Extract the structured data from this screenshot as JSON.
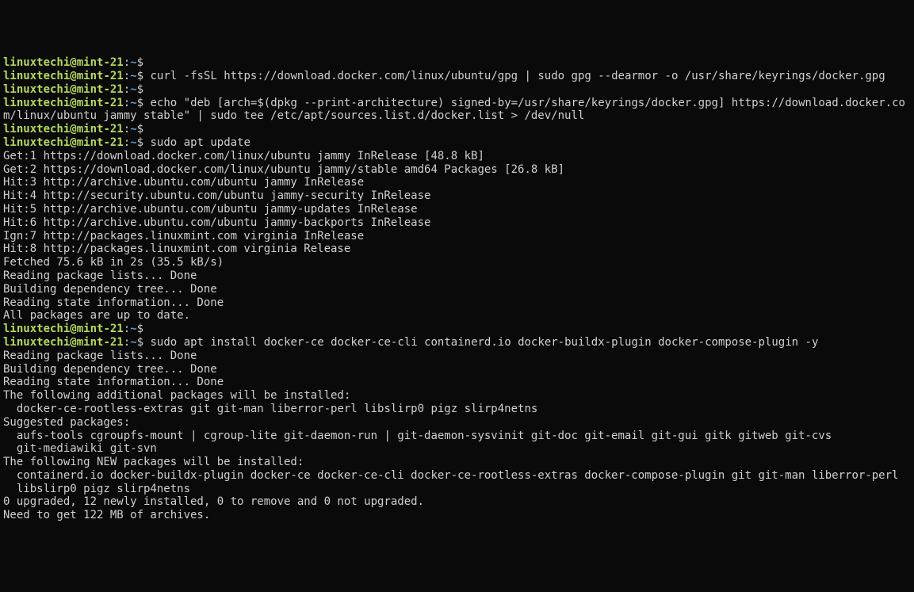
{
  "prompt": {
    "user": "linuxtechi",
    "at": "@",
    "host": "mint-21",
    "colon": ":",
    "path": "~",
    "dollar": "$"
  },
  "lines": [
    {
      "type": "prompt",
      "cmd": ""
    },
    {
      "type": "prompt",
      "cmd": "curl -fsSL https://download.docker.com/linux/ubuntu/gpg | sudo gpg --dearmor -o /usr/share/keyrings/docker.gpg"
    },
    {
      "type": "prompt",
      "cmd": ""
    },
    {
      "type": "prompt",
      "cmd": "echo \"deb [arch=$(dpkg --print-architecture) signed-by=/usr/share/keyrings/docker.gpg] https://download.docker.com/linux/ubuntu jammy stable\" | sudo tee /etc/apt/sources.list.d/docker.list > /dev/null"
    },
    {
      "type": "prompt",
      "cmd": ""
    },
    {
      "type": "prompt",
      "cmd": "sudo apt update"
    },
    {
      "type": "output",
      "text": "Get:1 https://download.docker.com/linux/ubuntu jammy InRelease [48.8 kB]"
    },
    {
      "type": "output",
      "text": "Get:2 https://download.docker.com/linux/ubuntu jammy/stable amd64 Packages [26.8 kB]"
    },
    {
      "type": "output",
      "text": "Hit:3 http://archive.ubuntu.com/ubuntu jammy InRelease"
    },
    {
      "type": "output",
      "text": "Hit:4 http://security.ubuntu.com/ubuntu jammy-security InRelease"
    },
    {
      "type": "output",
      "text": "Hit:5 http://archive.ubuntu.com/ubuntu jammy-updates InRelease"
    },
    {
      "type": "output",
      "text": "Hit:6 http://archive.ubuntu.com/ubuntu jammy-backports InRelease"
    },
    {
      "type": "output",
      "text": "Ign:7 http://packages.linuxmint.com virginia InRelease"
    },
    {
      "type": "output",
      "text": "Hit:8 http://packages.linuxmint.com virginia Release"
    },
    {
      "type": "output",
      "text": "Fetched 75.6 kB in 2s (35.5 kB/s)"
    },
    {
      "type": "output",
      "text": "Reading package lists... Done"
    },
    {
      "type": "output",
      "text": "Building dependency tree... Done"
    },
    {
      "type": "output",
      "text": "Reading state information... Done"
    },
    {
      "type": "output",
      "text": "All packages are up to date."
    },
    {
      "type": "prompt",
      "cmd": ""
    },
    {
      "type": "prompt",
      "cmd": "sudo apt install docker-ce docker-ce-cli containerd.io docker-buildx-plugin docker-compose-plugin -y"
    },
    {
      "type": "output",
      "text": "Reading package lists... Done"
    },
    {
      "type": "output",
      "text": "Building dependency tree... Done"
    },
    {
      "type": "output",
      "text": "Reading state information... Done"
    },
    {
      "type": "output",
      "text": "The following additional packages will be installed:"
    },
    {
      "type": "output",
      "text": "  docker-ce-rootless-extras git git-man liberror-perl libslirp0 pigz slirp4netns"
    },
    {
      "type": "output",
      "text": "Suggested packages:"
    },
    {
      "type": "output",
      "text": "  aufs-tools cgroupfs-mount | cgroup-lite git-daemon-run | git-daemon-sysvinit git-doc git-email git-gui gitk gitweb git-cvs"
    },
    {
      "type": "output",
      "text": "  git-mediawiki git-svn"
    },
    {
      "type": "output",
      "text": "The following NEW packages will be installed:"
    },
    {
      "type": "output",
      "text": "  containerd.io docker-buildx-plugin docker-ce docker-ce-cli docker-ce-rootless-extras docker-compose-plugin git git-man liberror-perl"
    },
    {
      "type": "output",
      "text": "  libslirp0 pigz slirp4netns"
    },
    {
      "type": "output",
      "text": "0 upgraded, 12 newly installed, 0 to remove and 0 not upgraded."
    },
    {
      "type": "output",
      "text": "Need to get 122 MB of archives."
    }
  ]
}
